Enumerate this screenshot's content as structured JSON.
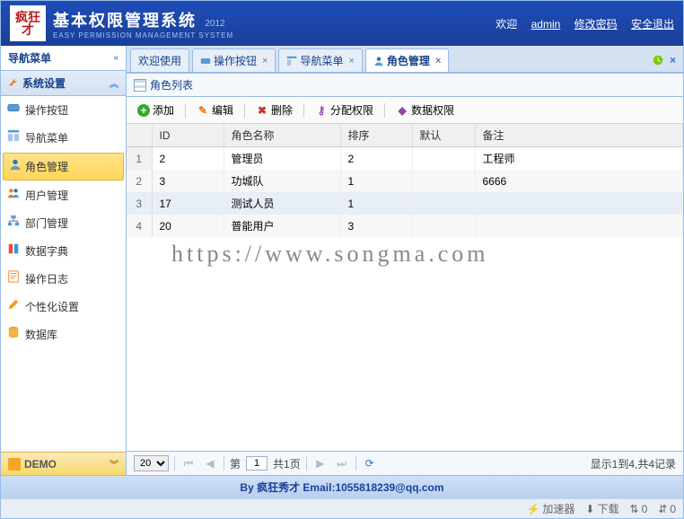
{
  "header": {
    "logo_text": "疯狂才",
    "title": "基本权限管理系统",
    "year": "2012",
    "subtitle": "EASY PERMISSION MANAGEMENT SYSTEM",
    "welcome": "欢迎",
    "username": "admin",
    "change_pwd": "修改密码",
    "logout": "安全退出"
  },
  "sidebar": {
    "nav_title": "导航菜单",
    "section_title": "系统设置",
    "items": [
      {
        "label": "操作按钮"
      },
      {
        "label": "导航菜单"
      },
      {
        "label": "角色管理"
      },
      {
        "label": "用户管理"
      },
      {
        "label": "部门管理"
      },
      {
        "label": "数据字典"
      },
      {
        "label": "操作日志"
      },
      {
        "label": "个性化设置"
      },
      {
        "label": "数据库"
      }
    ],
    "demo_label": "DEMO"
  },
  "tabs": [
    {
      "label": "欢迎使用",
      "closable": false
    },
    {
      "label": "操作按钮",
      "closable": true
    },
    {
      "label": "导航菜单",
      "closable": true
    },
    {
      "label": "角色管理",
      "closable": true
    }
  ],
  "grid": {
    "title": "角色列表",
    "toolbar": {
      "add": "添加",
      "edit": "编辑",
      "delete": "删除",
      "assign": "分配权限",
      "data": "数据权限"
    },
    "columns": [
      "ID",
      "角色名称",
      "排序",
      "默认",
      "备注"
    ],
    "rows": [
      {
        "id": "2",
        "name": "管理员",
        "sort": "2",
        "def": "",
        "remark": "工程师"
      },
      {
        "id": "3",
        "name": "功城队",
        "sort": "1",
        "def": "",
        "remark": "6666"
      },
      {
        "id": "17",
        "name": "测试人员",
        "sort": "1",
        "def": "",
        "remark": ""
      },
      {
        "id": "20",
        "name": "普能用户",
        "sort": "3",
        "def": "",
        "remark": ""
      }
    ],
    "watermark": "https://www.songma.com"
  },
  "pager": {
    "page_size": "20",
    "page_label_pre": "第",
    "current_page": "1",
    "total_pages_label": "共1页",
    "display_info": "显示1到4,共4记录"
  },
  "footer": {
    "text": "By 疯狂秀才 Email:1055818239@qq.com"
  },
  "statusbar": {
    "accel": "加速器",
    "download": "下载",
    "net1": "0",
    "net2": "0"
  }
}
